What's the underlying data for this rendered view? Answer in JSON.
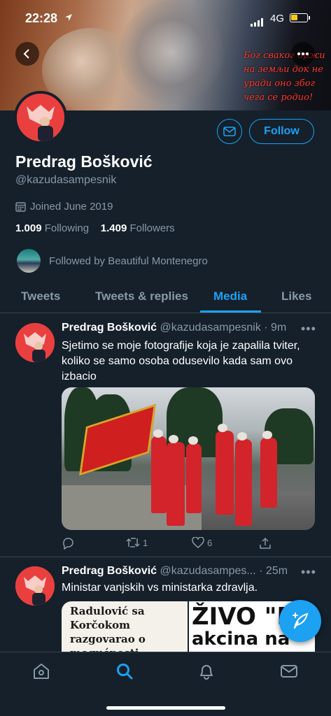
{
  "status_bar": {
    "time": "22:28",
    "network": "4G"
  },
  "banner": {
    "quote": "Бог сваког држи на земљи док не уради оно због чега се родио!"
  },
  "profile": {
    "name": "Predrag Bošković",
    "handle": "@kazudasampesnik",
    "joined": "Joined June 2019",
    "following_count": "1.009",
    "following_label": "Following",
    "followers_count": "1.409",
    "followers_label": "Followers",
    "followed_by": "Followed by Beautiful Montenegro",
    "follow_label": "Follow"
  },
  "tabs": [
    {
      "label": "Tweets"
    },
    {
      "label": "Tweets & replies"
    },
    {
      "label": "Media"
    },
    {
      "label": "Likes"
    }
  ],
  "tweets": [
    {
      "name": "Predrag Bošković",
      "handle_time": "@kazudasampesnik · 9m",
      "text": "Sjetimo se moje fotografije koja je zapalila tviter, koliko se samo osoba odusevilo kada sam ovo izbacio",
      "retweets": "1",
      "likes": "6"
    },
    {
      "name": "Predrag Bošković",
      "handle_time": "@kazudasampes... · 25m",
      "text": "Ministar vanjskih vs ministarka zdravlja.",
      "news_left": "Radulović sa Korčokom razgovarao o mogućnosti donacije i nabavke vakcina",
      "news_right_big": "ŽIVO \"R",
      "news_right_small": "akcina na"
    }
  ],
  "colors": {
    "background": "#15202b",
    "accent": "#1da1f2",
    "muted": "#8899a6",
    "divider": "#38444d"
  },
  "icons": [
    "back-icon",
    "more-icon",
    "mail-icon",
    "calendar-icon",
    "reply-icon",
    "retweet-icon",
    "like-icon",
    "share-icon",
    "compose-icon",
    "home-icon",
    "search-icon",
    "notifications-icon",
    "messages-icon"
  ]
}
